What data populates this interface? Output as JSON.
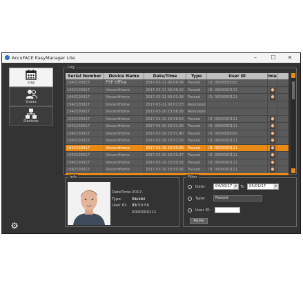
{
  "window": {
    "title": "AccuFACE EasyManager Lite",
    "minimize": "–",
    "maximize": "☐",
    "close": "✕"
  },
  "sidebar": {
    "items": [
      {
        "label": "Log",
        "icon": "calendar-icon",
        "active": true
      },
      {
        "label": "Users",
        "icon": "users-icon",
        "active": false
      },
      {
        "label": "Devices",
        "icon": "devices-icon",
        "active": false
      }
    ],
    "settings_icon": "gear-icon"
  },
  "log": {
    "group_label": "Log",
    "columns": [
      "Serial Number",
      "Device Name",
      "Date/Time",
      "Type",
      "User ID",
      "image"
    ],
    "rows": [
      {
        "serial": "1942103017",
        "device": "PSP Office",
        "datetime": "2017-03-11 00:06:54",
        "type": "Passed",
        "user_id": "ID: 0000000022",
        "image": false,
        "selected": false
      },
      {
        "serial": "1942103017",
        "device": "VincentHome",
        "datetime": "2017-03-11 00:06:22",
        "type": "Passed",
        "user_id": "ID: 0000000111",
        "image": true,
        "selected": false
      },
      {
        "serial": "1942103017",
        "device": "VincentHome",
        "datetime": "2017-03-11 00:02:38",
        "type": "Passed",
        "user_id": "ID: 0000000111",
        "image": true,
        "selected": false
      },
      {
        "serial": "1942103017",
        "device": "VincentHome",
        "datetime": "2017-03-11 00:02:23",
        "type": "Relocated",
        "user_id": "",
        "image": false,
        "selected": false
      },
      {
        "serial": "1942103017",
        "device": "VincentHome",
        "datetime": "2017-03-10 23:58:26",
        "type": "Relocated",
        "user_id": "",
        "image": false,
        "selected": false
      },
      {
        "serial": "1942103017",
        "device": "VincentHome",
        "datetime": "2017-03-10 23:56:54",
        "type": "Passed",
        "user_id": "ID: 0000000111",
        "image": true,
        "selected": false
      },
      {
        "serial": "1942103017",
        "device": "VincentHome",
        "datetime": "2017-03-10 23:51:56",
        "type": "Passed",
        "user_id": "ID: 0000000111",
        "image": true,
        "selected": false
      },
      {
        "serial": "1942103017",
        "device": "VincentHome",
        "datetime": "2017-03-10 23:51:40",
        "type": "Passed",
        "user_id": "ID: 0000000010",
        "image": true,
        "selected": false
      },
      {
        "serial": "1942103017",
        "device": "VincentHome",
        "datetime": "2017-03-10 23:51:33",
        "type": "Passed",
        "user_id": "ID: 0000000111",
        "image": true,
        "selected": false
      },
      {
        "serial": "1942103017",
        "device": "VincentHome",
        "datetime": "2017-03-10 23:50:56",
        "type": "Passed",
        "user_id": "ID: 0000000111",
        "image": true,
        "selected": true
      },
      {
        "serial": "1942103017",
        "device": "VincentHome",
        "datetime": "2017-03-10 23:50:37",
        "type": "Passed",
        "user_id": "ID: 0000000111",
        "image": true,
        "selected": false
      },
      {
        "serial": "1942103017",
        "device": "VincentHome",
        "datetime": "2017-03-10 23:50:32",
        "type": "Passed",
        "user_id": "ID: 0000000111",
        "image": true,
        "selected": false
      },
      {
        "serial": "1942103017",
        "device": "VincentHome",
        "datetime": "2017-03-10 23:50:26",
        "type": "Passed",
        "user_id": "ID: 0000000111",
        "image": true,
        "selected": false
      },
      {
        "serial": "1942103017",
        "device": "VincentHome",
        "datetime": "2017-03-10 23:50:23",
        "type": "Relocated",
        "user_id": "",
        "image": false,
        "selected": false
      }
    ]
  },
  "info": {
    "group_label": "Info",
    "datetime_label": "DateTime:",
    "datetime_value": "2017-03-10 23:50:56",
    "type_label": "Type:",
    "type_value": "Passed",
    "userid_label": "User ID:",
    "userid_value": "ID: 0000000111"
  },
  "filter": {
    "group_label": "Filter",
    "date_label": "Date:",
    "date_from": "04/30/17",
    "date_to_label": "To",
    "date_to": "05/01/17",
    "type_label": "Type:",
    "type_value": "Passed",
    "userid_label": "User ID:",
    "userid_value": "",
    "apply_label": "Apply"
  },
  "colors": {
    "background": "#333333",
    "accent": "#e98a16",
    "row": "#5a5a5a",
    "header": "#bfbfbf"
  }
}
